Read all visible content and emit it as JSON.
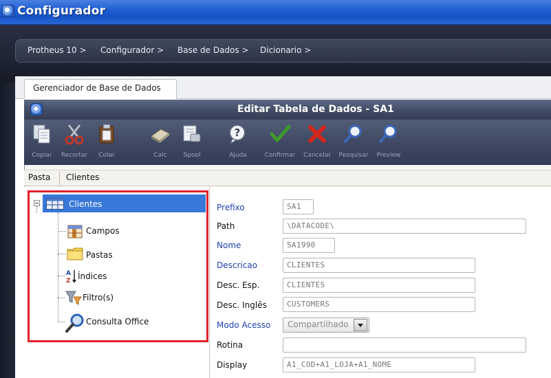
{
  "app": {
    "title": "Configurador"
  },
  "breadcrumb": {
    "items": [
      "Protheus 10 >",
      "Configurador >",
      "Base de Dados >",
      "Dicionario >"
    ]
  },
  "tab": {
    "label": "Gerenciador de Base de Dados"
  },
  "window": {
    "title": "Editar Tabela de Dados - SA1"
  },
  "toolbar": {
    "buttons": [
      {
        "label": "Copiar",
        "icon": "copy-icon"
      },
      {
        "label": "Recortar",
        "icon": "scissors-icon"
      },
      {
        "label": "Colar",
        "icon": "paste-icon"
      },
      {
        "label": "Calc",
        "icon": "calculator-icon"
      },
      {
        "label": "Spool",
        "icon": "spool-icon"
      },
      {
        "label": "Ajuda",
        "icon": "help-icon"
      },
      {
        "label": "Confirmar",
        "icon": "check-icon"
      },
      {
        "label": "Cancelar",
        "icon": "cancel-icon"
      },
      {
        "label": "Pesquisar",
        "icon": "search-icon"
      },
      {
        "label": "Preview",
        "icon": "preview-icon"
      }
    ]
  },
  "pasta": {
    "label": "Pasta",
    "value": "Clientes"
  },
  "tree": {
    "root": {
      "label": "Clientes",
      "icon": "table-icon"
    },
    "children": [
      {
        "label": "Campos",
        "icon": "fields-icon"
      },
      {
        "label": "Pastas",
        "icon": "folder-icon"
      },
      {
        "label": "Índices",
        "icon": "sort-az-icon"
      },
      {
        "label": "Filtro(s)",
        "icon": "filter-icon"
      },
      {
        "label": "Consulta Office",
        "icon": "magnifier-icon"
      }
    ]
  },
  "form": {
    "prefixo": {
      "label": "Prefixo",
      "value": "SA1"
    },
    "path": {
      "label": "Path",
      "value": "\\DATACODE\\"
    },
    "nome": {
      "label": "Nome",
      "value": "SA1990"
    },
    "descricao": {
      "label": "Descricao",
      "value": "CLIENTES"
    },
    "desc_esp": {
      "label": "Desc. Esp.",
      "value": "CLIENTES"
    },
    "desc_ingles": {
      "label": "Desc. Inglês",
      "value": "CUSTOMERS"
    },
    "modo_acesso": {
      "label": "Modo Acesso",
      "value": "Compartilhado"
    },
    "rotina": {
      "label": "Rotina",
      "value": ""
    },
    "display": {
      "label": "Display",
      "value": "A1_COD+A1_LOJA+A1_NOME"
    }
  },
  "colors": {
    "title_bar": "#1f5fd4",
    "selection": "#3878d8",
    "highlight_border": "#e2202a",
    "required_label": "#1d3fb0"
  }
}
